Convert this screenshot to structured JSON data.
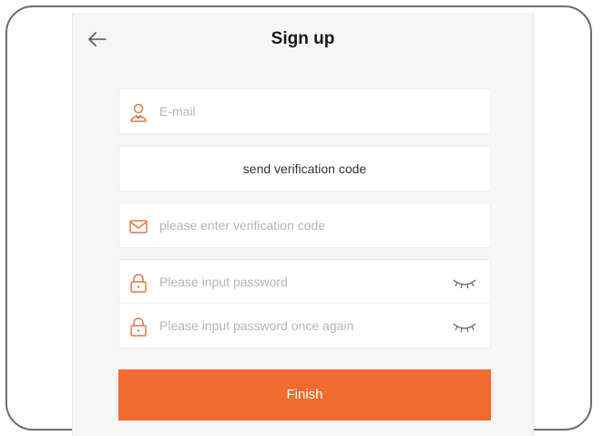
{
  "header": {
    "title": "Sign up",
    "back_icon": "arrow-left-icon"
  },
  "form": {
    "email": {
      "placeholder": "E-mail",
      "value": "",
      "icon": "user-icon"
    },
    "send_code_label": "send verification code",
    "verification_code": {
      "placeholder": "please enter verification code",
      "value": "",
      "icon": "envelope-icon"
    },
    "password": {
      "placeholder": "Please input password",
      "value": "",
      "icon": "lock-icon",
      "toggle_icon": "eye-closed-icon"
    },
    "confirm_password": {
      "placeholder": "Please input password once again",
      "value": "",
      "icon": "lock-icon",
      "toggle_icon": "eye-closed-icon"
    },
    "finish_label": "Finish"
  },
  "colors": {
    "accent": "#f26b2e",
    "icon": "#e0784a",
    "background": "#f6f6f6"
  }
}
